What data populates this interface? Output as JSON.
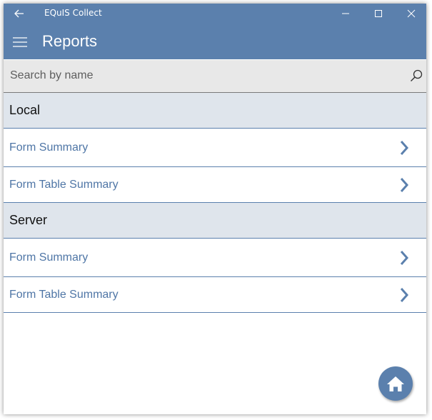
{
  "titlebar": {
    "app_title": "EQuIS Collect",
    "back_icon": "arrow-left-icon",
    "minimize_icon": "minimize-icon",
    "maximize_icon": "maximize-icon",
    "close_icon": "close-icon"
  },
  "header": {
    "menu_icon": "hamburger-icon",
    "title": "Reports"
  },
  "search": {
    "placeholder": "Search by name",
    "value": "",
    "icon": "search-icon"
  },
  "groups": [
    {
      "title": "Local",
      "items": [
        {
          "label": "Form Summary",
          "icon": "chevron-right-icon"
        },
        {
          "label": "Form Table Summary",
          "icon": "chevron-right-icon"
        }
      ]
    },
    {
      "title": "Server",
      "items": [
        {
          "label": "Form Summary",
          "icon": "chevron-right-icon"
        },
        {
          "label": "Form Table Summary",
          "icon": "chevron-right-icon"
        }
      ]
    }
  ],
  "fab": {
    "icon": "home-icon"
  },
  "colors": {
    "accent": "#5b80ad",
    "group_header_bg": "#dfe5ec",
    "search_bg": "#e8e8e8",
    "link_text": "#4f76a6"
  }
}
